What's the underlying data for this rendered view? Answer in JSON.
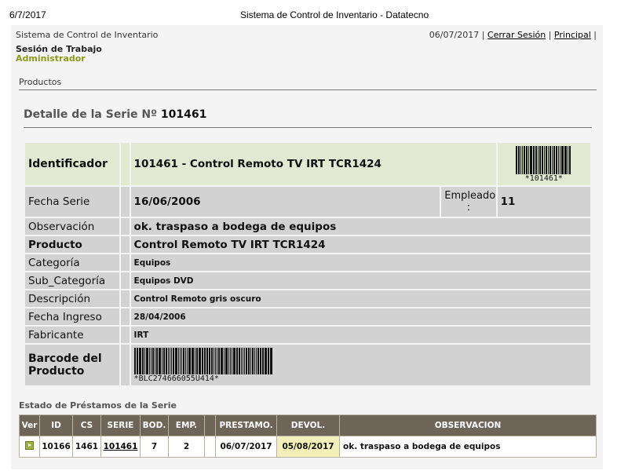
{
  "print": {
    "date": "6/7/2017",
    "title": "Sistema de Control de Inventario - Datatecno"
  },
  "header": {
    "app_name": "Sistema de Control de Inventario",
    "date": "06/07/2017",
    "sep1": " | ",
    "logout": "Cerrar Sesión",
    "sep2": " | ",
    "home": "Principal",
    "sep3": " |",
    "session_label": "Sesión de Trabajo",
    "session_role": "Administrador"
  },
  "breadcrumb": "Productos",
  "detail": {
    "title_prefix": "Detalle de la Serie Nº",
    "serie_number": "101461",
    "identificador_label": "Identificador",
    "identificador_value": "101461 - Control Remoto TV IRT TCR1424",
    "barcode_serie_text": "*101461*",
    "fecha_serie_label": "Fecha Serie",
    "fecha_serie_value": "16/06/2006",
    "empleado_label": "Empleado :",
    "empleado_value": "11",
    "observacion_label": "Observación",
    "observacion_value": "ok. traspaso a bodega de equipos",
    "producto_label": "Producto",
    "producto_value": "Control Remoto TV IRT TCR1424",
    "categoria_label": "Categoría",
    "categoria_value": "Equipos",
    "subcategoria_label": "Sub_Categoría",
    "subcategoria_value": "Equipos DVD",
    "descripcion_label": "Descripción",
    "descripcion_value": "Control Remoto gris oscuro",
    "fecha_ingreso_label": "Fecha Ingreso",
    "fecha_ingreso_value": "28/04/2006",
    "fabricante_label": "Fabricante",
    "fabricante_value": "IRT",
    "barcode_producto_label": "Barcode del Producto",
    "barcode_producto_text": "*BLC274666055U414*"
  },
  "loans": {
    "title": "Estado de Préstamos de la Serie",
    "columns": [
      "Ver",
      "ID",
      "CS",
      "SERIE",
      "BOD.",
      "EMP.",
      "",
      "PRESTAMO.",
      "DEVOL.",
      "OBSERVACION"
    ],
    "rows": [
      {
        "id": "10166",
        "cs": "1461",
        "serie": "101461",
        "bod": "7",
        "emp": "2",
        "blank": "",
        "prestamo": "06/07/2017",
        "devol": "05/08/2017",
        "observacion": "ok. traspaso a bodega de equipos"
      }
    ]
  },
  "colors": {
    "row_bg": "#d2d2d2",
    "ident_bg": "#e2e8d2",
    "table_header_bg": "#6e6457",
    "devol_bg": "#f2f0b8",
    "role_color": "#8a9a1a"
  },
  "icons": {
    "view_row": "arrow-right-icon"
  }
}
